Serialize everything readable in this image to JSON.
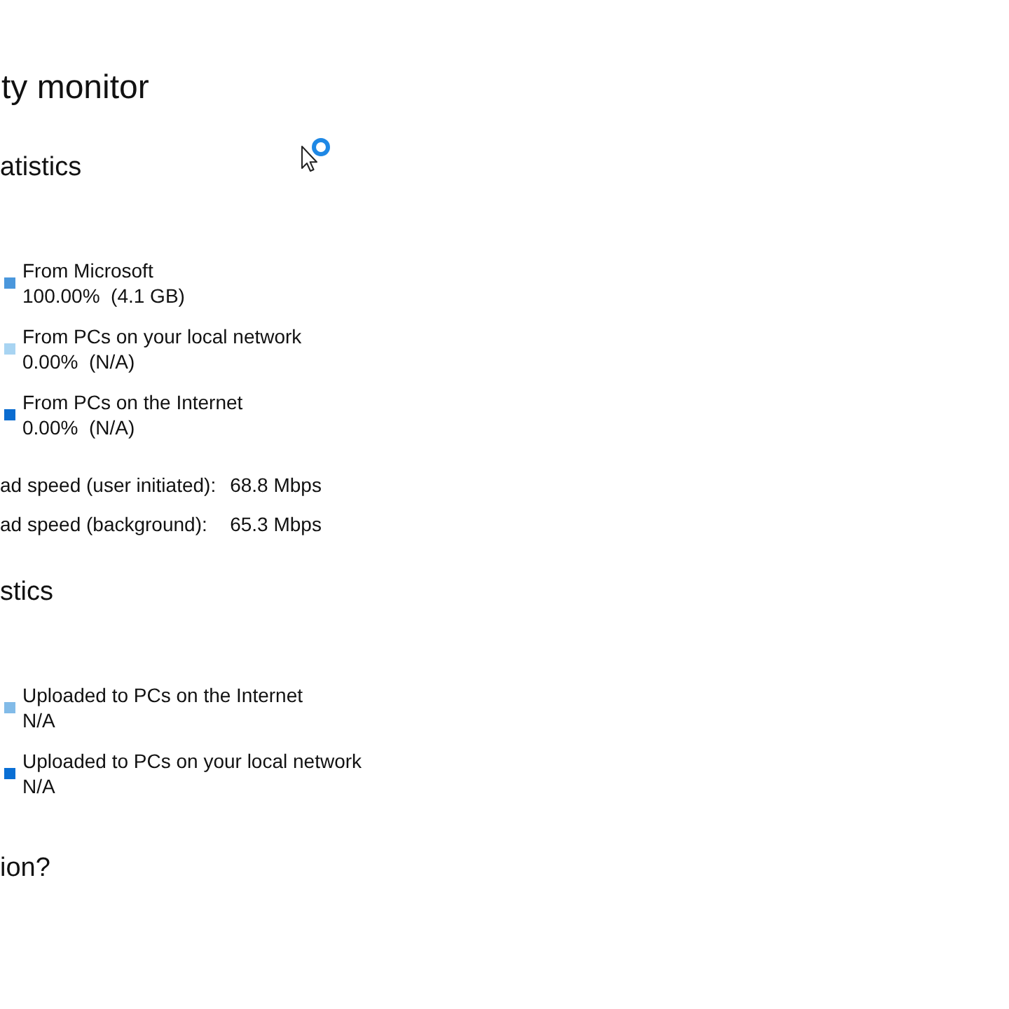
{
  "page": {
    "title": "ty monitor"
  },
  "download_statistics": {
    "heading": "atistics",
    "sources": [
      {
        "label": "From Microsoft",
        "value": "100.00%  (4.1 GB)",
        "color": "#4a97dc"
      },
      {
        "label": "From PCs on your local network",
        "value": "0.00%  (N/A)",
        "color": "#a8d4f2"
      },
      {
        "label": "From PCs on the Internet",
        "value": "0.00%  (N/A)",
        "color": "#0b6cd0"
      }
    ],
    "speeds": [
      {
        "label": "ad speed (user initiated):",
        "value": "68.8 Mbps"
      },
      {
        "label": "ad speed (background):",
        "value": "65.3 Mbps"
      }
    ]
  },
  "upload_statistics": {
    "heading": "stics",
    "items": [
      {
        "label": "Uploaded to PCs on the Internet",
        "value": "N/A",
        "color": "#82bbe8"
      },
      {
        "label": "Uploaded to PCs on your local network",
        "value": "N/A",
        "color": "#0a6fd4"
      }
    ]
  },
  "next_heading": "ion?"
}
